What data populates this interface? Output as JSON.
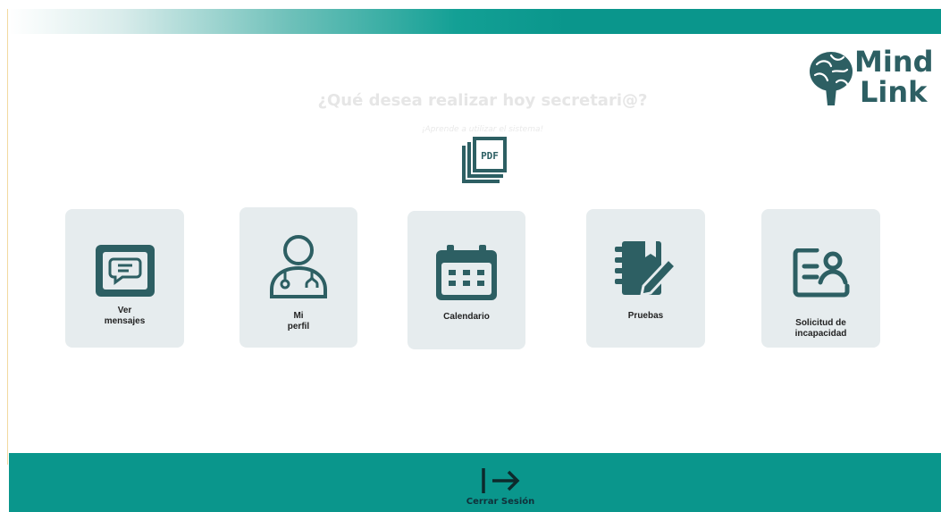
{
  "brand": {
    "line1": "Mind",
    "line2": "Link"
  },
  "header": {
    "title": "¿Qué desea realizar hoy secretari@?",
    "subtitle": "¡Aprende a utilizar el sistema!"
  },
  "pdf": {
    "icon": "pdf-icon"
  },
  "cards": [
    {
      "label": "Ver\nmensajes",
      "icon": "message-icon"
    },
    {
      "label": "Mi\nperfil",
      "icon": "doctor-icon"
    },
    {
      "label": "Calendario",
      "icon": "calendar-icon"
    },
    {
      "label": "Pruebas",
      "icon": "notebook-pen-icon"
    },
    {
      "label": "Solicitud de\nincapacidad",
      "icon": "id-card-icon"
    }
  ],
  "footer": {
    "logout_label": "Cerrar Sesión",
    "icon": "logout-arrow-icon"
  },
  "colors": {
    "teal": "#0a968c",
    "dark_teal": "#2d5f63",
    "card_bg": "#e6ecee"
  }
}
